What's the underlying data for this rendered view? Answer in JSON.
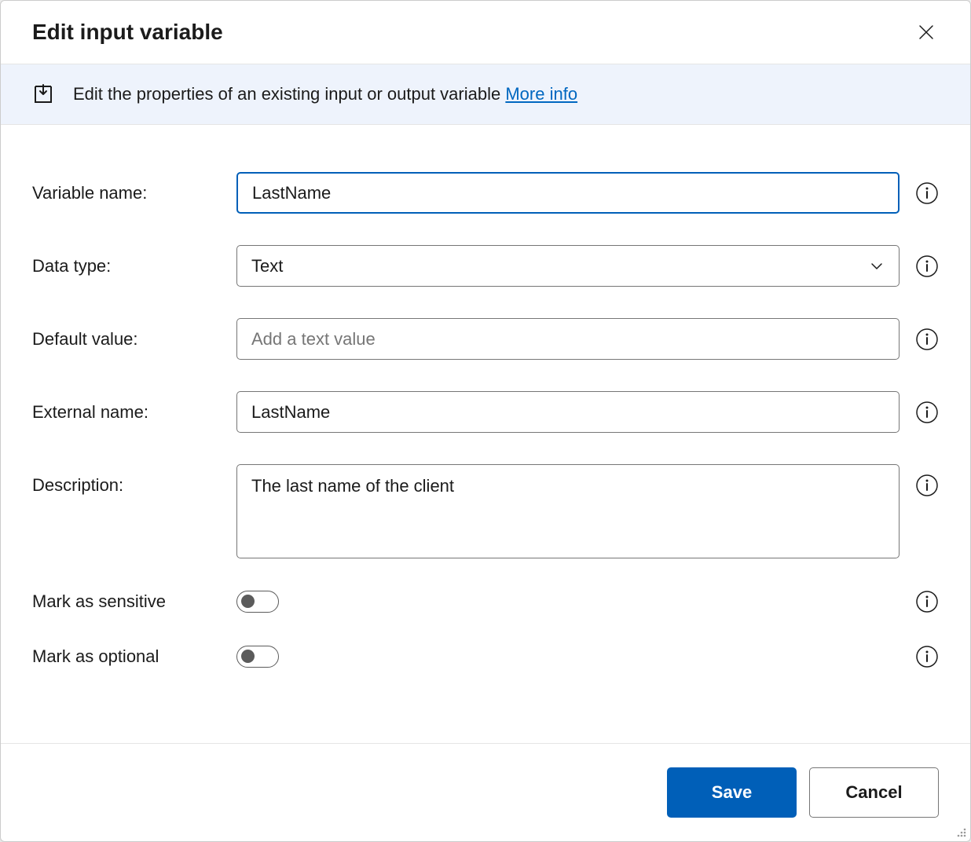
{
  "dialog": {
    "title": "Edit input variable",
    "banner": {
      "text": "Edit the properties of an existing input or output variable",
      "link": "More info"
    }
  },
  "form": {
    "variable_name": {
      "label": "Variable name:",
      "value": "LastName"
    },
    "data_type": {
      "label": "Data type:",
      "value": "Text"
    },
    "default_value": {
      "label": "Default value:",
      "value": "",
      "placeholder": "Add a text value"
    },
    "external_name": {
      "label": "External name:",
      "value": "LastName"
    },
    "description": {
      "label": "Description:",
      "value": "The last name of the client"
    },
    "mark_sensitive": {
      "label": "Mark as sensitive",
      "value": false
    },
    "mark_optional": {
      "label": "Mark as optional",
      "value": false
    }
  },
  "footer": {
    "save": "Save",
    "cancel": "Cancel"
  }
}
